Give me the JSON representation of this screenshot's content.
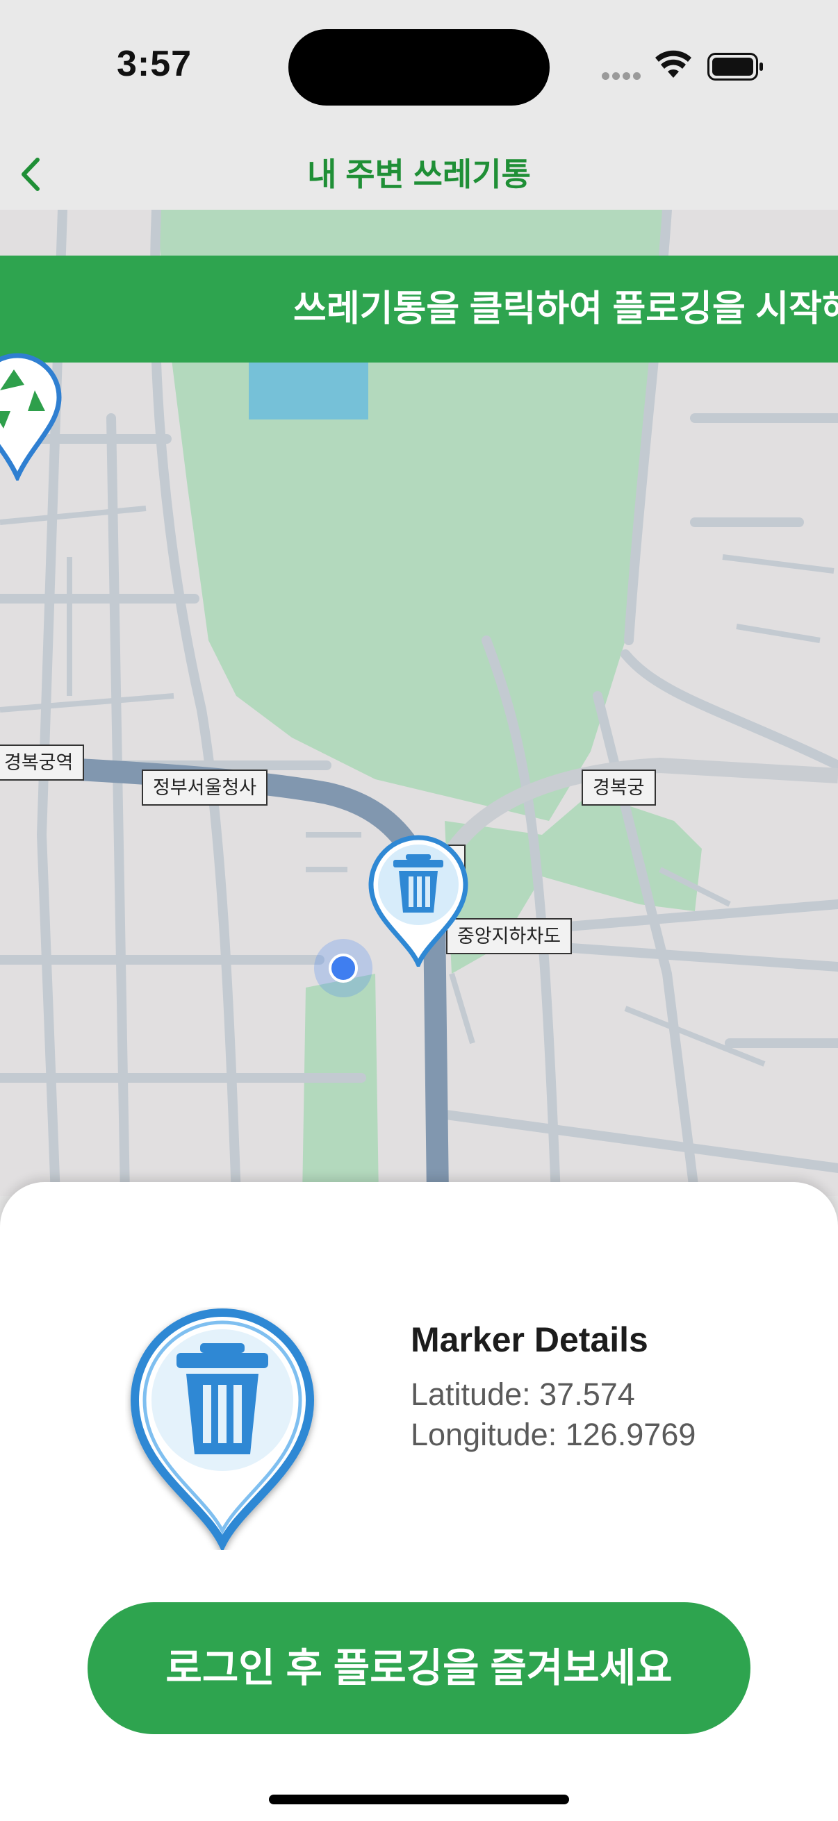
{
  "status_bar": {
    "time": "3:57",
    "icons": [
      "cellular-dots-icon",
      "wifi-icon",
      "battery-icon"
    ]
  },
  "nav": {
    "title": "내 주변 쓰레기통",
    "back_icon": "chevron-left-icon"
  },
  "banner": {
    "text": "쓰레기통을 클릭하여 플로깅을 시작해"
  },
  "map": {
    "labels": [
      "경복궁역",
      "정부서울청사",
      "경복궁",
      "중앙지하차도"
    ],
    "markers": [
      "trash-bin-marker",
      "recycle-marker"
    ]
  },
  "sheet": {
    "title": "Marker Details",
    "latitude": "Latitude: 37.574",
    "longitude": "Longitude: 126.9769",
    "button_label": "로그인 후 플로깅을 즐겨보세요"
  },
  "colors": {
    "brand_green": "#2ea44f",
    "title_green": "#1f8f36",
    "marker_blue": "#2f88d4"
  }
}
